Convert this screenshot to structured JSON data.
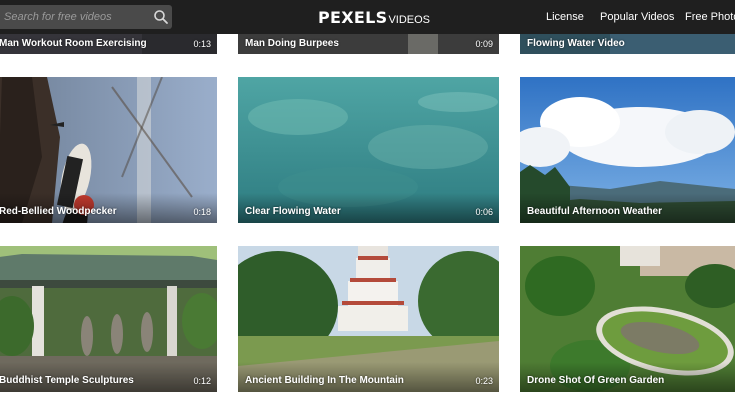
{
  "header": {
    "search": {
      "placeholder": "Search for free videos",
      "icon": "search-icon"
    },
    "logo": {
      "main": "PEXELS",
      "sub": "VIDEOS"
    },
    "nav": [
      {
        "label": "License"
      },
      {
        "label": "Popular Videos"
      },
      {
        "label": "Free Photos"
      }
    ]
  },
  "videos": [
    {
      "title": "Man Workout Room Exercising",
      "duration": "0:13"
    },
    {
      "title": "Man Doing Burpees",
      "duration": "0:09"
    },
    {
      "title": "Flowing Water Video",
      "duration": ""
    },
    {
      "title": "Red-Bellied Woodpecker",
      "duration": "0:18"
    },
    {
      "title": "Clear Flowing Water",
      "duration": "0:06"
    },
    {
      "title": "Beautiful Afternoon Weather",
      "duration": ""
    },
    {
      "title": "Buddhist Temple Sculptures",
      "duration": "0:12"
    },
    {
      "title": "Ancient Building In The Mountain",
      "duration": "0:23"
    },
    {
      "title": "Drone Shot Of Green Garden",
      "duration": ""
    }
  ],
  "colors": {
    "header_bg": "#1f1f1f",
    "page_bg": "#ffffff",
    "search_bg": "#4a4a4a"
  }
}
